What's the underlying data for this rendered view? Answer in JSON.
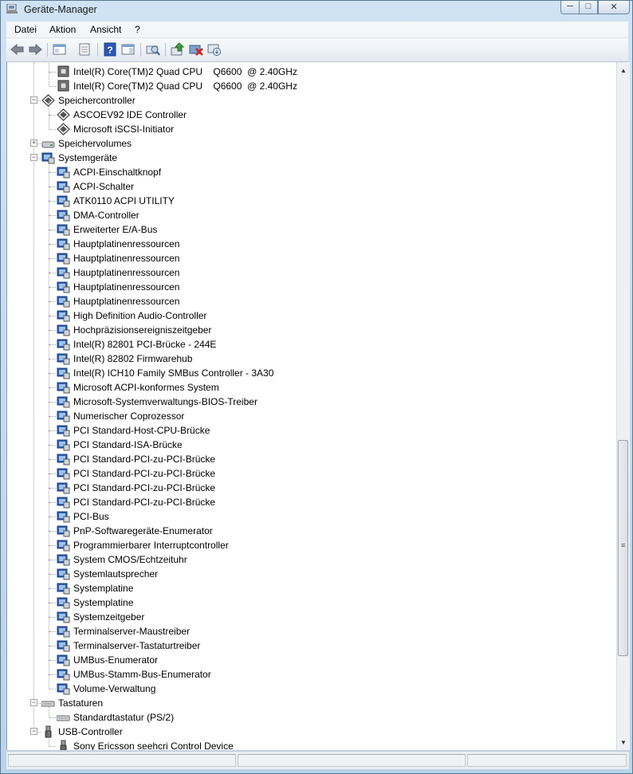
{
  "window": {
    "title": "Geräte-Manager",
    "icon": "device-manager-icon",
    "controls": {
      "minimize": "─",
      "maximize": "□",
      "close": "✕"
    }
  },
  "menubar": {
    "items": [
      "Datei",
      "Aktion",
      "Ansicht",
      "?"
    ]
  },
  "toolbar": {
    "buttons": [
      "back-arrow-icon",
      "forward-arrow-icon",
      "show-hide-console-tree-icon",
      "properties-icon",
      "help-icon",
      "show-action-pane-icon",
      "scan-hardware-icon",
      "update-driver-icon",
      "uninstall-icon",
      "disable-device-icon"
    ]
  },
  "tree": {
    "processors": [
      "Intel(R) Core(TM)2 Quad CPU    Q6600  @ 2.40GHz",
      "Intel(R) Core(TM)2 Quad CPU    Q6600  @ 2.40GHz"
    ],
    "storage_controllers": {
      "label": "Speichercontroller",
      "children": [
        "ASCOEV92 IDE Controller",
        "Microsoft iSCSI-Initiator"
      ]
    },
    "storage_volumes": {
      "label": "Speichervolumes"
    },
    "system_devices": {
      "label": "Systemgeräte",
      "children": [
        "ACPI-Einschaltknopf",
        "ACPI-Schalter",
        "ATK0110 ACPI UTILITY",
        "DMA-Controller",
        "Erweiterter E/A-Bus",
        "Hauptplatinenressourcen",
        "Hauptplatinenressourcen",
        "Hauptplatinenressourcen",
        "Hauptplatinenressourcen",
        "Hauptplatinenressourcen",
        "High Definition Audio-Controller",
        "Hochpräzisionsereigniszeitgeber",
        "Intel(R) 82801 PCI-Brücke - 244E",
        "Intel(R) 82802 Firmwarehub",
        "Intel(R) ICH10 Family SMBus Controller - 3A30",
        "Microsoft ACPI-konformes System",
        "Microsoft-Systemverwaltungs-BIOS-Treiber",
        "Numerischer Coprozessor",
        "PCI Standard-Host-CPU-Brücke",
        "PCI Standard-ISA-Brücke",
        "PCI Standard-PCI-zu-PCI-Brücke",
        "PCI Standard-PCI-zu-PCI-Brücke",
        "PCI Standard-PCI-zu-PCI-Brücke",
        "PCI Standard-PCI-zu-PCI-Brücke",
        "PCI-Bus",
        "PnP-Softwaregeräte-Enumerator",
        "Programmierbarer Interruptcontroller",
        "System CMOS/Echtzeituhr",
        "Systemlautsprecher",
        "Systemplatine",
        "Systemplatine",
        "Systemzeitgeber",
        "Terminalserver-Maustreiber",
        "Terminalserver-Tastaturtreiber",
        "UMBus-Enumerator",
        "UMBus-Stamm-Bus-Enumerator",
        "Volume-Verwaltung"
      ]
    },
    "keyboards": {
      "label": "Tastaturen",
      "children": [
        "Standardtastatur (PS/2)"
      ]
    },
    "usb_controllers": {
      "label": "USB-Controller",
      "children": [
        "Sony Ericsson seehcri Control Device"
      ]
    }
  },
  "scrollbar": {
    "up": "▲",
    "down": "▼",
    "grip": "≡"
  },
  "tree_glyphs": {
    "expanded": "−",
    "collapsed": "+"
  },
  "colors": {
    "titlebar": "#cfe3f5",
    "content_bg": "#ffffff",
    "frame": "#5a7896"
  }
}
